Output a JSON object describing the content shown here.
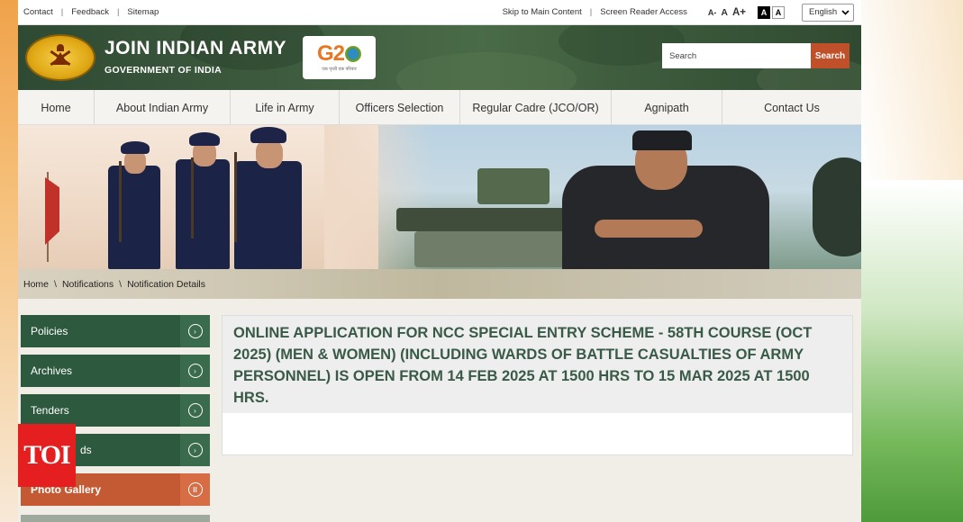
{
  "utility_bar": {
    "links": [
      "Contact",
      "Feedback",
      "Sitemap"
    ],
    "skip_link": "Skip to Main Content",
    "screen_reader": "Screen Reader Access",
    "font_sizes": [
      "A-",
      "A",
      "A+"
    ],
    "contrast": [
      "A",
      "A"
    ],
    "language": "English"
  },
  "header": {
    "title": "JOIN INDIAN ARMY",
    "subtitle": "GOVERNMENT OF INDIA",
    "g20_text": "G2",
    "g20_sub": "एक पृथ्वी एक परिवार",
    "search_placeholder": "Search",
    "search_button": "Search"
  },
  "nav": {
    "items": [
      {
        "label": "Home"
      },
      {
        "label": "About Indian Army"
      },
      {
        "label": "Life in Army"
      },
      {
        "label": "Officers Selection"
      },
      {
        "label": "Regular Cadre (JCO/OR)"
      },
      {
        "label": "Agnipath"
      },
      {
        "label": "Contact Us"
      }
    ]
  },
  "breadcrumb": [
    "Home",
    "Notifications",
    "Notification Details"
  ],
  "sidebar": {
    "items": [
      {
        "label": "Policies"
      },
      {
        "label": "Archives"
      },
      {
        "label": "Tenders"
      },
      {
        "label": "ds"
      },
      {
        "label": "Photo Gallery"
      }
    ]
  },
  "notice": {
    "title": "ONLINE APPLICATION FOR NCC SPECIAL ENTRY SCHEME - 58TH COURSE (OCT 2025) (MEN & WOMEN) (INCLUDING WARDS OF BATTLE CASUALTIES OF ARMY PERSONNEL) IS OPEN FROM 14 FEB 2025 AT 1500 HRS TO 15 MAR 2025 AT 1500 HRS."
  },
  "watermark": {
    "text": "TOI"
  },
  "colors": {
    "header_green": "#3d5a3e",
    "sidebar_green": "#2d5a3e",
    "accent_orange": "#c45a33",
    "search_button": "#c0502a",
    "notice_text": "#3a5a49"
  }
}
